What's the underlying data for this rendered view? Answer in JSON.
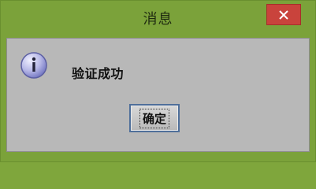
{
  "window": {
    "title": "消息"
  },
  "dialog": {
    "icon": "info-icon",
    "message": "验证成功",
    "ok_label": "确定"
  },
  "colors": {
    "frame": "#7ba23a",
    "close_button": "#c9433c",
    "content_bg": "#b8b8b8",
    "button_border": "#4f6f9a"
  }
}
